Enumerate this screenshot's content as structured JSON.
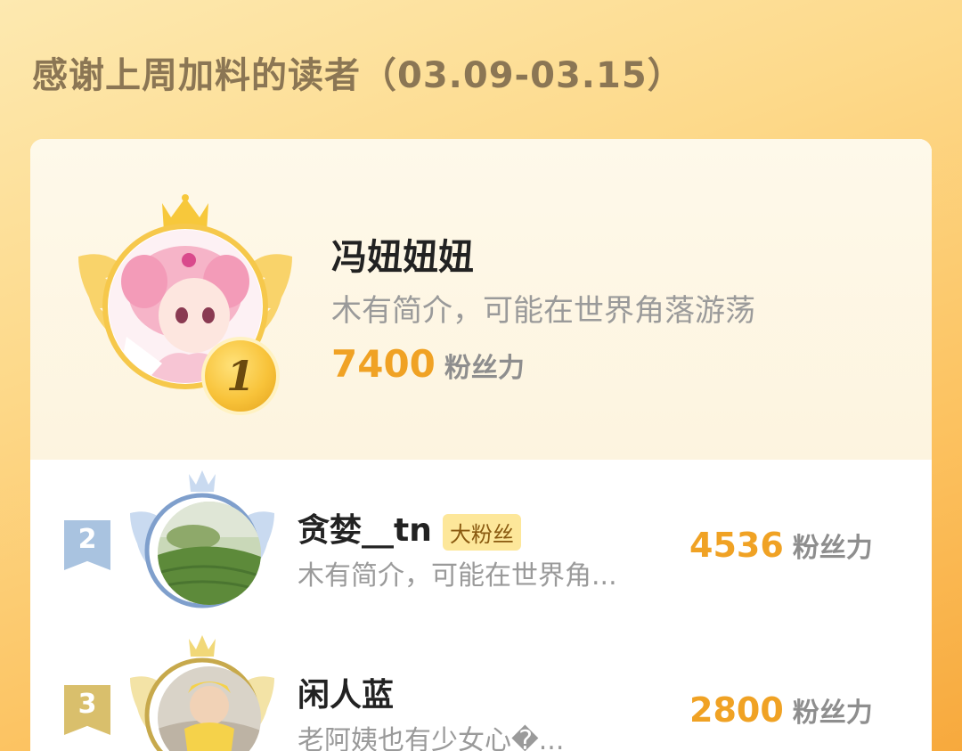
{
  "header": {
    "title": "感谢上周加料的读者（03.09-03.15）"
  },
  "leaderboard": {
    "first": {
      "rank": "1",
      "name": "冯妞妞妞",
      "bio": "木有简介，可能在世界角落游荡",
      "score": "7400",
      "unit": "粉丝力"
    },
    "others": [
      {
        "rank": "2",
        "name": "贪婪__tn",
        "tag": "大粉丝",
        "bio": "木有简介，可能在世界角...",
        "score": "4536",
        "unit": "粉丝力",
        "flag_color": "#a9c3e0"
      },
      {
        "rank": "3",
        "name": "闲人蓝",
        "bio": "老阿姨也有少女心�...",
        "score": "2800",
        "unit": "粉丝力",
        "flag_color": "#d9bf6c"
      }
    ]
  },
  "colors": {
    "accent": "#f0a224",
    "title": "#8b7654",
    "gold": "#f8c33a",
    "silver": "#a9c3e0"
  },
  "icons": {
    "crown": "crown-icon",
    "wings": "wings-icon",
    "rank_badge": "rank-badge-icon"
  }
}
